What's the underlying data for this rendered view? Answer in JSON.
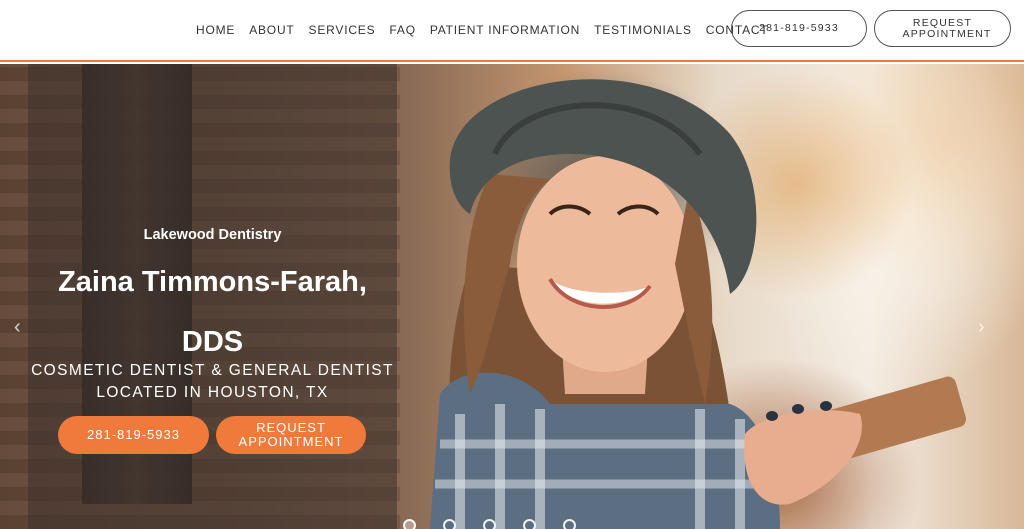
{
  "nav": {
    "items": [
      "HOME",
      "ABOUT",
      "SERVICES",
      "FAQ",
      "PATIENT INFORMATION",
      "TESTIMONIALS",
      "CONTACT"
    ]
  },
  "header_buttons": {
    "phone": "281-819-5933",
    "request": "REQUEST APPOINTMENT"
  },
  "hero": {
    "practice": "Lakewood Dentistry",
    "name": "Zaina Timmons-Farah, DDS",
    "subtitle": "COSMETIC DENTIST & GENERAL DENTIST LOCATED IN HOUSTON, TX",
    "phone_button": "281-819-5933",
    "request_button": "REQUEST APPOINTMENT",
    "prev_arrow": "‹",
    "next_arrow": "›"
  },
  "slider": {
    "slide_count": 5,
    "active_index": 0
  },
  "colors": {
    "accent": "#f07a3c",
    "overlay": "rgba(60,50,45,0.55)"
  }
}
